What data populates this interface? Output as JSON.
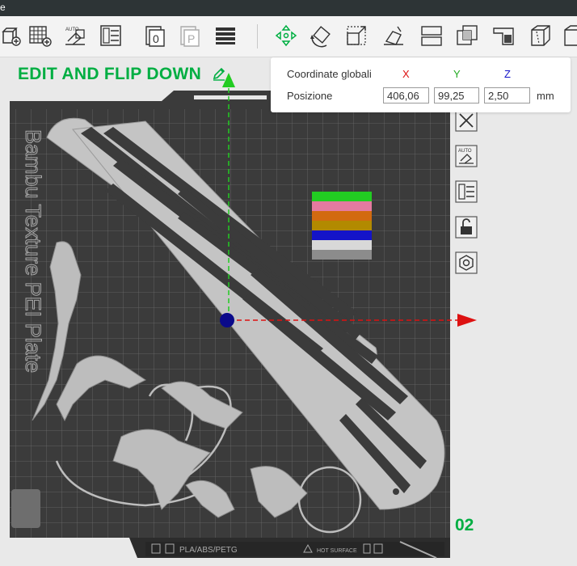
{
  "titlebar": {
    "text": "e"
  },
  "toolbar": {
    "items": [
      {
        "name": "add-plate-icon"
      },
      {
        "name": "arrange-grid-icon"
      },
      {
        "name": "auto-orient-icon"
      },
      {
        "name": "layout-icon"
      },
      {
        "name": "plate-zero-icon"
      },
      {
        "name": "plate-p-icon"
      },
      {
        "name": "layers-icon"
      },
      {
        "name": "move-icon"
      },
      {
        "name": "rotate-icon"
      },
      {
        "name": "scale-icon"
      },
      {
        "name": "lay-on-face-icon"
      },
      {
        "name": "split-icon"
      },
      {
        "name": "cut-icon"
      },
      {
        "name": "support-paint-icon"
      },
      {
        "name": "seam-paint-icon"
      },
      {
        "name": "cube-icon"
      }
    ]
  },
  "plate": {
    "label": "EDIT AND FLIP DOWN",
    "number": "02",
    "watermark": "Bambu Texture PEI Plate",
    "footer": {
      "filament": "PLA/ABS/PETG",
      "surface": "HOT SURFACE"
    }
  },
  "coords": {
    "title": "Coordinate globali",
    "row_label": "Posizione",
    "axes": {
      "x": "X",
      "y": "Y",
      "z": "Z"
    },
    "x": "406,06",
    "y": "99,25",
    "z": "2,50",
    "unit": "mm"
  },
  "colors": {
    "accent": "#00ae42",
    "swatches": [
      "#22cc22",
      "#e47aa0",
      "#d26a10",
      "#b28a00",
      "#1414c8",
      "#d8d8d8",
      "#8c8c8c"
    ]
  }
}
